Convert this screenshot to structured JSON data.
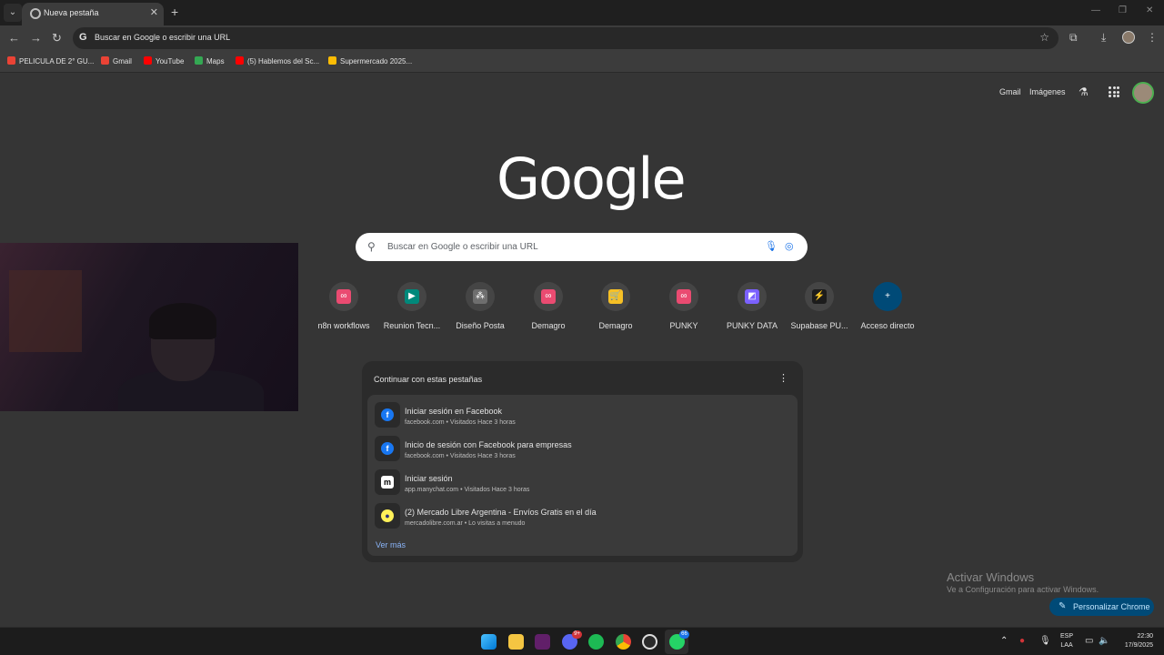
{
  "browser": {
    "tab_title": "Nueva pestaña",
    "omnibox_text": "Buscar en Google o escribir una URL",
    "bookmarks": [
      {
        "label": "PELICULA DE 2° GU...",
        "color": "#ea4335"
      },
      {
        "label": "Gmail",
        "color": "#ea4335"
      },
      {
        "label": "YouTube",
        "color": "#ff0000"
      },
      {
        "label": "Maps",
        "color": "#34a853"
      },
      {
        "label": "(5) Hablemos del Sc...",
        "color": "#ff0000"
      },
      {
        "label": "Supermercado 2025...",
        "color": "#fbbc04"
      }
    ]
  },
  "page": {
    "gmail_link": "Gmail",
    "images_link": "Imágenes",
    "logo_text": "Google",
    "search_placeholder": "Buscar en Google o escribir una URL",
    "shortcuts": [
      {
        "label": "n8n workflows",
        "color": "#ea4b71",
        "glyph": "∞"
      },
      {
        "label": "Reunion Tecn...",
        "color": "#00897b",
        "glyph": "▶"
      },
      {
        "label": "Diseño Posta",
        "color": "#6e6e6e",
        "glyph": "⁂"
      },
      {
        "label": "Demagro",
        "color": "#ea4b71",
        "glyph": "∞"
      },
      {
        "label": "Demagro",
        "color": "#f6c026",
        "glyph": "🛒"
      },
      {
        "label": "PUNKY",
        "color": "#ea4b71",
        "glyph": "∞"
      },
      {
        "label": "PUNKY DATA",
        "color": "#7b61ff",
        "glyph": "◩"
      },
      {
        "label": "Supabase PU...",
        "color": "#1c1c1c",
        "glyph": "⚡"
      },
      {
        "label": "Acceso directo",
        "color": "#004a77",
        "glyph": "+"
      }
    ],
    "continue_card": {
      "title": "Continuar con estas pestañas",
      "items": [
        {
          "title": "Iniciar sesión en Facebook",
          "sub": "facebook.com • Visitados Hace 3 horas",
          "glyph": "f",
          "color": "#1877f2"
        },
        {
          "title": "Inicio de sesión con Facebook para empresas",
          "sub": "facebook.com • Visitados Hace 3 horas",
          "glyph": "f",
          "color": "#1877f2"
        },
        {
          "title": "Iniciar sesión",
          "sub": "app.manychat.com • Visitados Hace 3 horas",
          "glyph": "m",
          "color": "#000000"
        },
        {
          "title": "(2) Mercado Libre Argentina - Envíos Gratis en el día",
          "sub": "mercadolibre.com.ar • Lo visitas a menudo",
          "glyph": "●",
          "color": "#fff159"
        }
      ],
      "see_more": "Ver más"
    },
    "activate_title": "Activar Windows",
    "activate_sub": "Ve a Configuración para activar Windows.",
    "customize_button": "Personalizar Chrome"
  },
  "taskbar": {
    "discord_badge": "9+",
    "whatsapp_badge": "66",
    "lang_line1": "ESP",
    "lang_line2": "LAA",
    "time": "22:30",
    "date": "17/9/2025"
  }
}
